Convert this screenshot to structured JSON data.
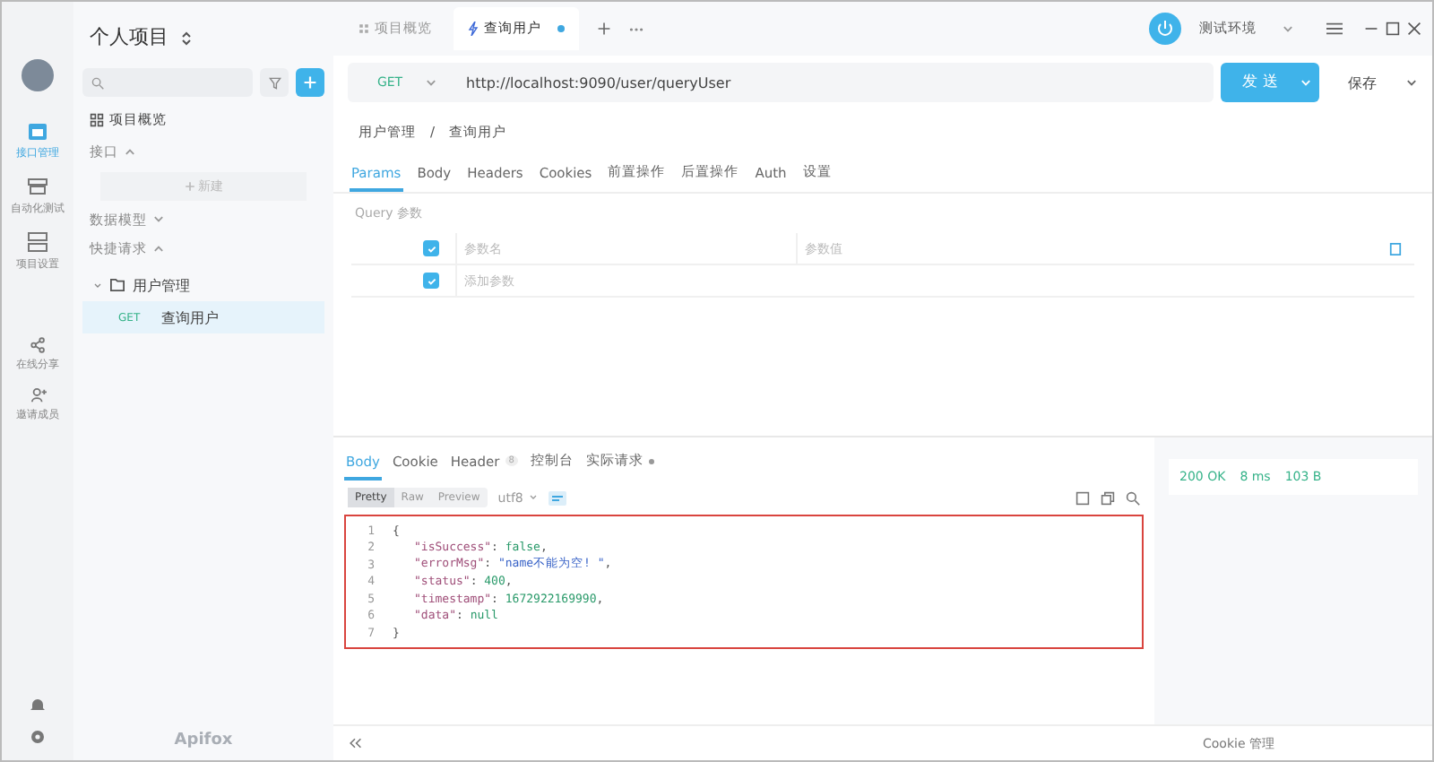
{
  "rail": {
    "items": [
      {
        "label": "接口管理",
        "selected": true
      },
      {
        "label": "自动化测试",
        "selected": false
      },
      {
        "label": "项目设置",
        "selected": false
      },
      {
        "label": "在线分享",
        "selected": false
      },
      {
        "label": "邀请成员",
        "selected": false
      }
    ]
  },
  "sidebar": {
    "title": "个人项目",
    "overview": "项目概览",
    "new_button": "新建",
    "sections": [
      {
        "label": "接口",
        "expanded": true
      },
      {
        "label": "数据模型",
        "expanded": false
      },
      {
        "label": "快捷请求",
        "expanded": true
      }
    ],
    "tree": [
      {
        "label": "用户管理",
        "expanded": true,
        "children": [
          {
            "method": "GET",
            "label": "查询用户",
            "selected": true
          }
        ]
      }
    ],
    "brand": "Apifox"
  },
  "tabs": [
    {
      "label": "项目概览",
      "selected": false,
      "unsaved": false
    },
    {
      "label": "查询用户",
      "selected": true,
      "unsaved": true
    }
  ],
  "environment": "测试环境",
  "request": {
    "method": "GET",
    "url": "http://localhost:9090/user/queryUser",
    "send": "发 送",
    "save": "保存"
  },
  "breadcrumb": [
    "用户管理",
    "查询用户"
  ],
  "breadcrumb_separator": "/",
  "request_tabs": [
    {
      "label": "Params",
      "selected": true
    },
    {
      "label": "Body",
      "selected": false
    },
    {
      "label": "Headers",
      "selected": false
    },
    {
      "label": "Cookies",
      "selected": false
    },
    {
      "label": "前置操作",
      "selected": false
    },
    {
      "label": "后置操作",
      "selected": false
    },
    {
      "label": "Auth",
      "selected": false
    },
    {
      "label": "设置",
      "selected": false
    }
  ],
  "query_title": "Query 参数",
  "params": [
    {
      "name_placeholder": "参数名",
      "value_placeholder": "参数值",
      "checked": true
    },
    {
      "name_placeholder": "添加参数",
      "checked": true
    }
  ],
  "response_tabs": [
    {
      "label": "Body",
      "selected": true,
      "dot": false
    },
    {
      "label": "Cookie",
      "selected": false,
      "dot": false
    },
    {
      "label": "Header",
      "badge": "8",
      "selected": false,
      "dot": false
    },
    {
      "label": "控制台",
      "selected": false,
      "dot": false
    },
    {
      "label": "实际请求",
      "dot": true,
      "selected": false
    }
  ],
  "view_modes": [
    {
      "label": "Pretty",
      "selected": true
    },
    {
      "label": "Raw",
      "selected": false
    },
    {
      "label": "Preview",
      "selected": false
    }
  ],
  "encoding": "utf8",
  "code": [
    [
      {
        "t": "{",
        "kind": "punct"
      }
    ],
    [
      {
        "t": "\"isSuccess\"",
        "kind": "key"
      },
      {
        "t": ": ",
        "kind": "punct"
      },
      {
        "t": "false",
        "kind": "literal"
      },
      {
        "t": ",",
        "kind": "punct"
      }
    ],
    [
      {
        "t": "\"errorMsg\"",
        "kind": "key"
      },
      {
        "t": ": ",
        "kind": "punct"
      },
      {
        "t": "\"name不能为空! \"",
        "kind": "string"
      },
      {
        "t": ",",
        "kind": "punct"
      }
    ],
    [
      {
        "t": "\"status\"",
        "kind": "key"
      },
      {
        "t": ": ",
        "kind": "punct"
      },
      {
        "t": "400",
        "kind": "number"
      },
      {
        "t": ",",
        "kind": "punct"
      }
    ],
    [
      {
        "t": "\"timestamp\"",
        "kind": "key"
      },
      {
        "t": ": ",
        "kind": "punct"
      },
      {
        "t": "1672922169990",
        "kind": "number"
      },
      {
        "t": ",",
        "kind": "punct"
      }
    ],
    [
      {
        "t": "\"data\"",
        "kind": "key"
      },
      {
        "t": ": ",
        "kind": "punct"
      },
      {
        "t": "null",
        "kind": "literal"
      }
    ],
    [
      {
        "t": "}",
        "kind": "punct"
      }
    ]
  ],
  "line_numbers": [
    "1",
    "2",
    "3",
    "4",
    "5",
    "6",
    "7"
  ],
  "status": {
    "code": "200 OK",
    "time": "8 ms",
    "size": "103 B"
  },
  "footer": {
    "cookie": "Cookie 管理"
  }
}
